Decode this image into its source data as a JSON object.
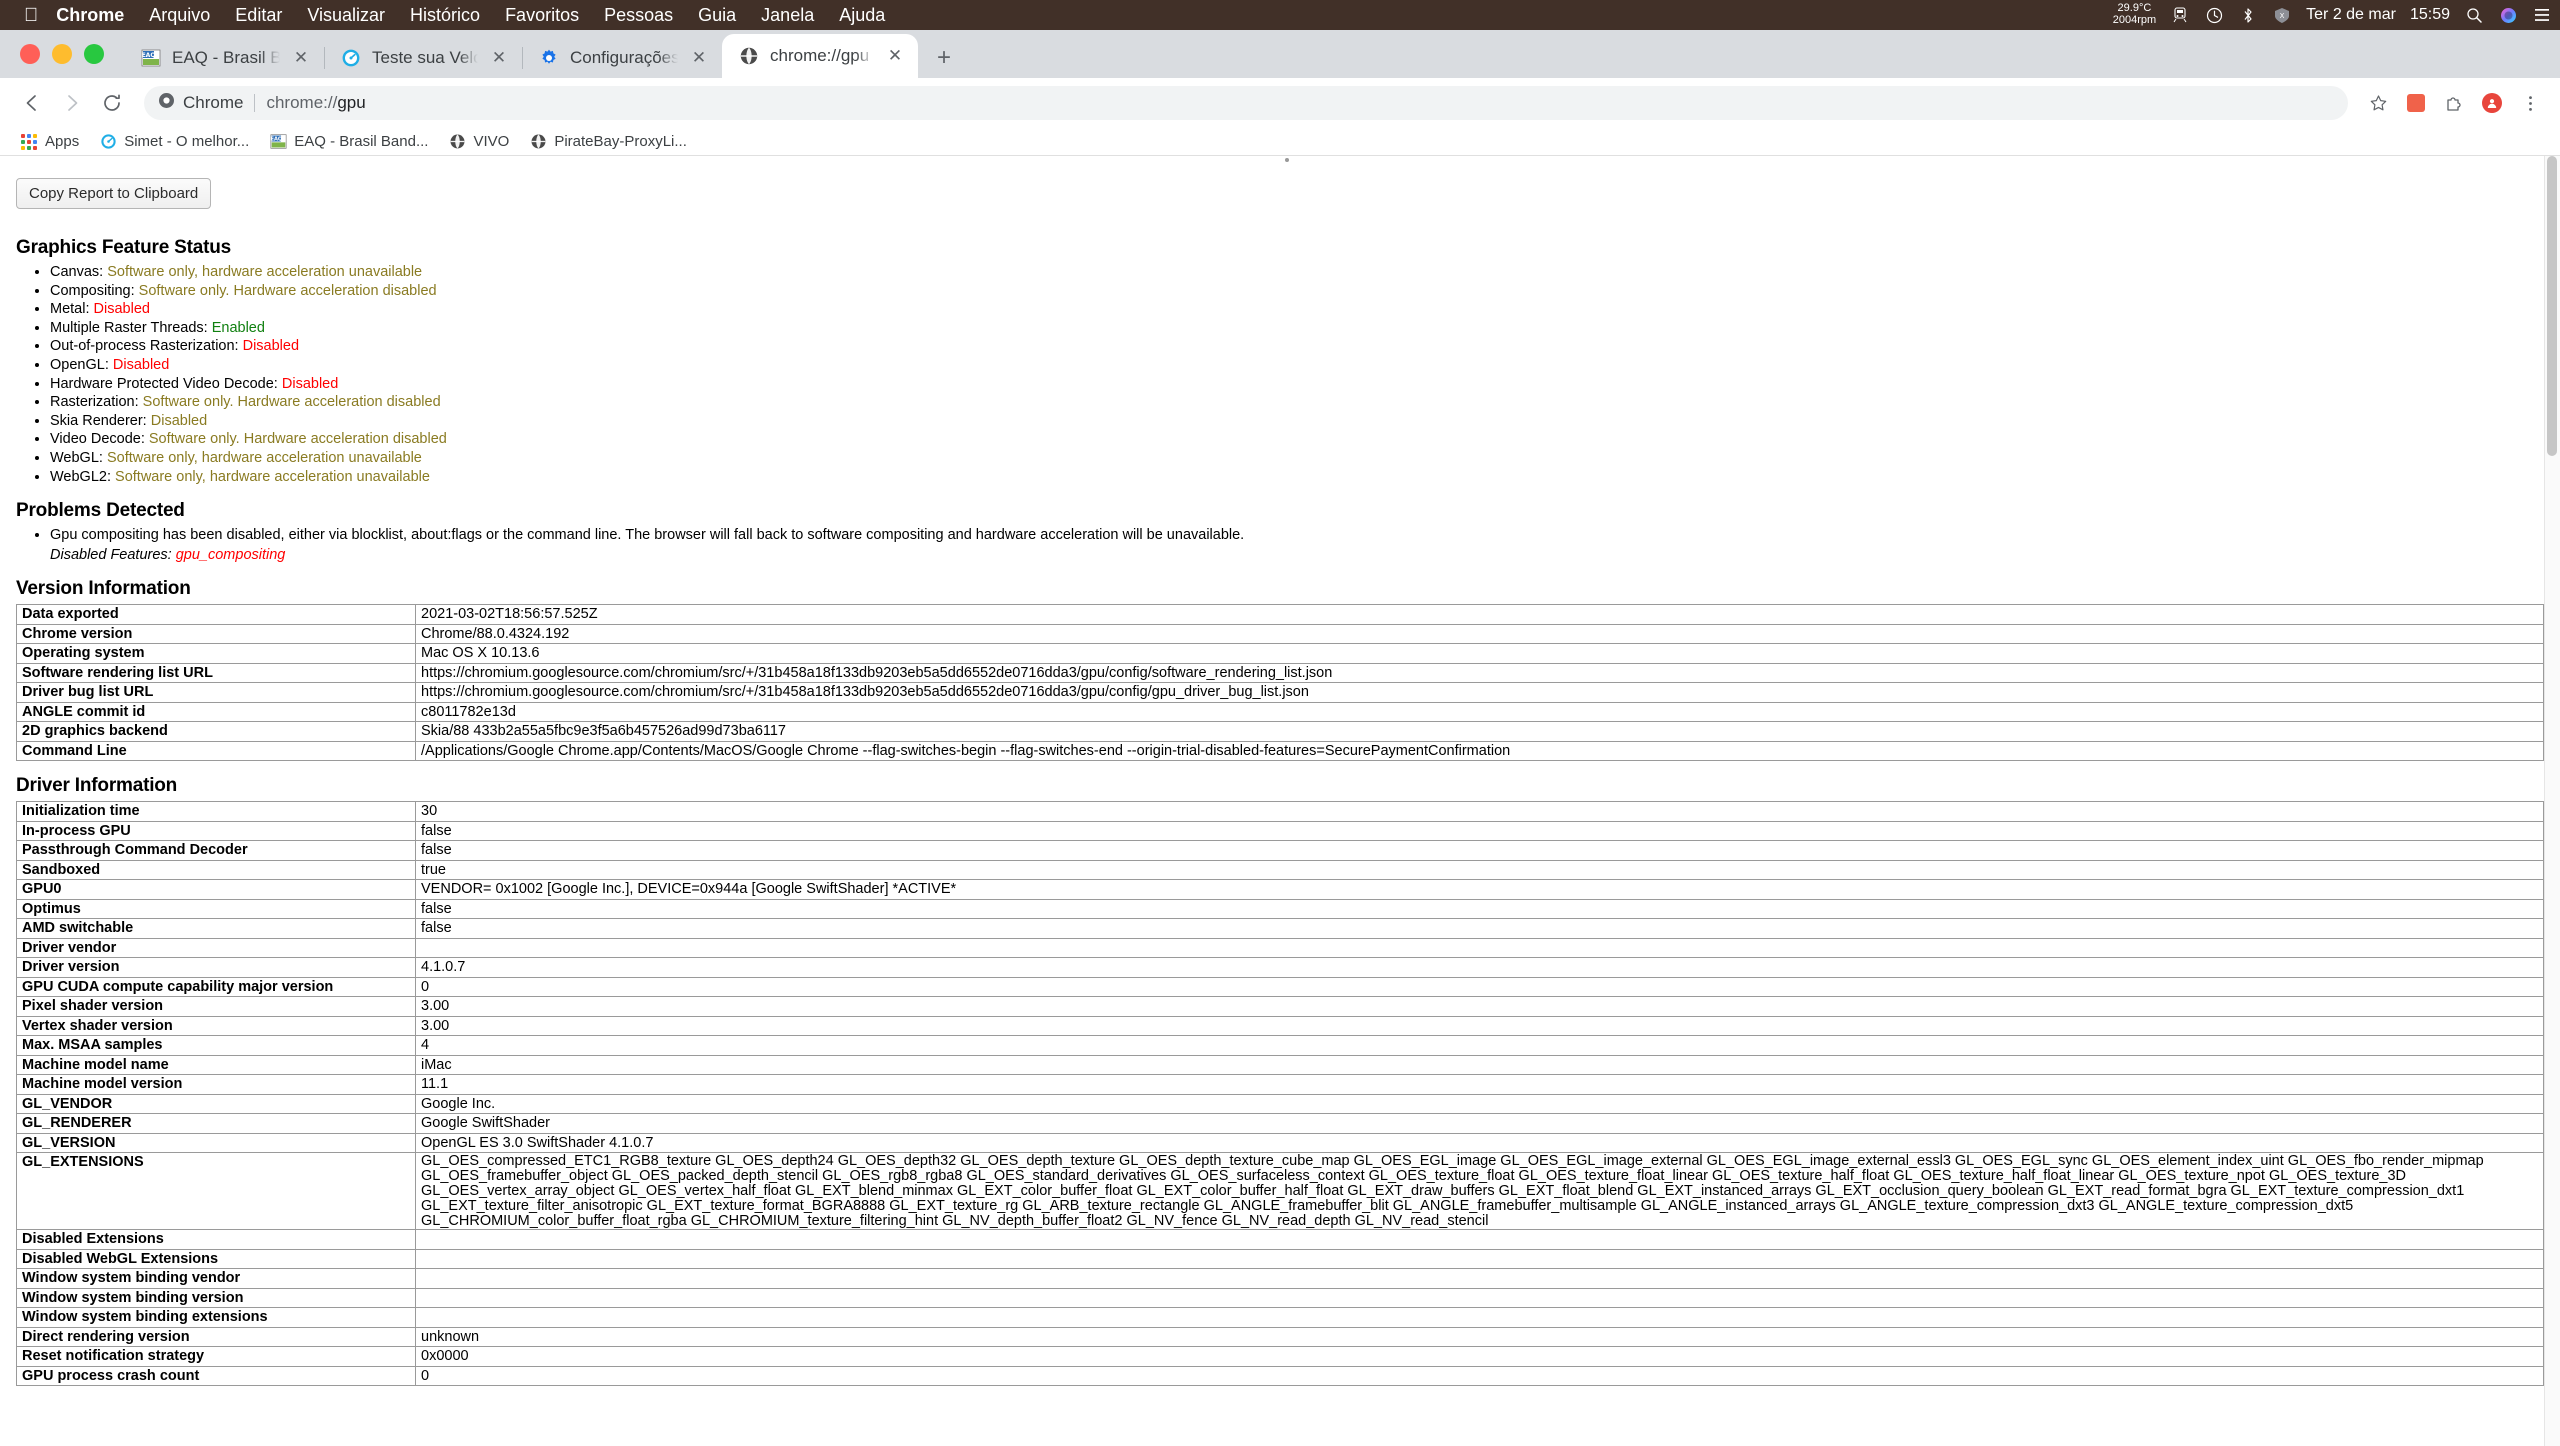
{
  "menubar": {
    "apple_icon": "apple-logo-icon",
    "items": [
      {
        "label": "Chrome",
        "bold": true
      },
      {
        "label": "Arquivo",
        "bold": false
      },
      {
        "label": "Editar",
        "bold": false
      },
      {
        "label": "Visualizar",
        "bold": false
      },
      {
        "label": "Histórico",
        "bold": false
      },
      {
        "label": "Favoritos",
        "bold": false
      },
      {
        "label": "Pessoas",
        "bold": false
      },
      {
        "label": "Guia",
        "bold": false
      },
      {
        "label": "Janela",
        "bold": false
      },
      {
        "label": "Ajuda",
        "bold": false
      }
    ],
    "status": {
      "temperature": "29.9°C",
      "fan_rpm": "2004rpm",
      "datetime": "Ter 2 de mar",
      "time": "15:59"
    }
  },
  "tabs": [
    {
      "title": "EAQ - Brasil Banda Larga - Me",
      "favicon": "eaq-icon",
      "active": false
    },
    {
      "title": "Teste sua Velocidade de Intern",
      "favicon": "speedtest-icon",
      "active": false
    },
    {
      "title": "Configurações: Sobre o Google",
      "favicon": "gear-icon",
      "active": false
    },
    {
      "title": "chrome://gpu",
      "favicon": "globe-icon",
      "active": true
    }
  ],
  "newtab_label": "+",
  "toolbar": {
    "back_label": "←",
    "forward_label": "→",
    "reload_label": "⟳",
    "omnibox_chip": "Chrome",
    "omnibox_url_prefix": "chrome://",
    "omnibox_url_suffix": "gpu",
    "star_label": "☆"
  },
  "bookmarks": [
    {
      "label": "Apps",
      "icon": "apps-grid-icon"
    },
    {
      "label": "Simet - O melhor...",
      "icon": "speedtest-icon"
    },
    {
      "label": "EAQ - Brasil Band...",
      "icon": "eaq-icon"
    },
    {
      "label": "VIVO",
      "icon": "globe-icon"
    },
    {
      "label": "PirateBay-ProxyLi...",
      "icon": "globe-icon"
    }
  ],
  "content": {
    "copy_button": "Copy Report to Clipboard",
    "graphics_feature_status_title": "Graphics Feature Status",
    "features": [
      {
        "name": "Canvas:",
        "status": "Software only, hardware acceleration unavailable",
        "level": "yellow"
      },
      {
        "name": "Compositing:",
        "status": "Software only. Hardware acceleration disabled",
        "level": "yellow"
      },
      {
        "name": "Metal:",
        "status": "Disabled",
        "level": "red"
      },
      {
        "name": "Multiple Raster Threads:",
        "status": "Enabled",
        "level": "green"
      },
      {
        "name": "Out-of-process Rasterization:",
        "status": "Disabled",
        "level": "red"
      },
      {
        "name": "OpenGL:",
        "status": "Disabled",
        "level": "red"
      },
      {
        "name": "Hardware Protected Video Decode:",
        "status": "Disabled",
        "level": "red"
      },
      {
        "name": "Rasterization:",
        "status": "Software only. Hardware acceleration disabled",
        "level": "yellow"
      },
      {
        "name": "Skia Renderer:",
        "status": "Disabled",
        "level": "yellow"
      },
      {
        "name": "Video Decode:",
        "status": "Software only. Hardware acceleration disabled",
        "level": "yellow"
      },
      {
        "name": "WebGL:",
        "status": "Software only, hardware acceleration unavailable",
        "level": "yellow"
      },
      {
        "name": "WebGL2:",
        "status": "Software only, hardware acceleration unavailable",
        "level": "yellow"
      }
    ],
    "problems_title": "Problems Detected",
    "problems": [
      {
        "text": "Gpu compositing has been disabled, either via blocklist, about:flags or the command line. The browser will fall back to software compositing and hardware acceleration will be unavailable.",
        "disabled_label": "Disabled Features:",
        "disabled_features": "gpu_compositing"
      }
    ],
    "version_title": "Version Information",
    "version_rows": [
      {
        "key": "Data exported",
        "value": "2021-03-02T18:56:57.525Z"
      },
      {
        "key": "Chrome version",
        "value": "Chrome/88.0.4324.192"
      },
      {
        "key": "Operating system",
        "value": "Mac OS X 10.13.6"
      },
      {
        "key": "Software rendering list URL",
        "value": "https://chromium.googlesource.com/chromium/src/+/31b458a18f133db9203eb5a5dd6552de0716dda3/gpu/config/software_rendering_list.json"
      },
      {
        "key": "Driver bug list URL",
        "value": "https://chromium.googlesource.com/chromium/src/+/31b458a18f133db9203eb5a5dd6552de0716dda3/gpu/config/gpu_driver_bug_list.json"
      },
      {
        "key": "ANGLE commit id",
        "value": "c8011782e13d"
      },
      {
        "key": "2D graphics backend",
        "value": "Skia/88 433b2a55a5fbc9e3f5a6b457526ad99d73ba6117"
      },
      {
        "key": "Command Line",
        "value": "/Applications/Google Chrome.app/Contents/MacOS/Google Chrome --flag-switches-begin --flag-switches-end --origin-trial-disabled-features=SecurePaymentConfirmation"
      }
    ],
    "driver_title": "Driver Information",
    "driver_rows": [
      {
        "key": "Initialization time",
        "value": "30"
      },
      {
        "key": "In-process GPU",
        "value": "false"
      },
      {
        "key": "Passthrough Command Decoder",
        "value": "false"
      },
      {
        "key": "Sandboxed",
        "value": "true"
      },
      {
        "key": "GPU0",
        "value": "VENDOR= 0x1002 [Google Inc.], DEVICE=0x944a [Google SwiftShader] *ACTIVE*"
      },
      {
        "key": "Optimus",
        "value": "false"
      },
      {
        "key": "AMD switchable",
        "value": "false"
      },
      {
        "key": "Driver vendor",
        "value": ""
      },
      {
        "key": "Driver version",
        "value": "4.1.0.7"
      },
      {
        "key": "GPU CUDA compute capability major version",
        "value": "0"
      },
      {
        "key": "Pixel shader version",
        "value": "3.00"
      },
      {
        "key": "Vertex shader version",
        "value": "3.00"
      },
      {
        "key": "Max. MSAA samples",
        "value": "4"
      },
      {
        "key": "Machine model name",
        "value": "iMac"
      },
      {
        "key": "Machine model version",
        "value": "11.1"
      },
      {
        "key": "GL_VENDOR",
        "value": "Google Inc."
      },
      {
        "key": "GL_RENDERER",
        "value": "Google SwiftShader"
      },
      {
        "key": "GL_VERSION",
        "value": "OpenGL ES 3.0 SwiftShader 4.1.0.7"
      },
      {
        "key": "GL_EXTENSIONS",
        "value": "GL_OES_compressed_ETC1_RGB8_texture GL_OES_depth24 GL_OES_depth32 GL_OES_depth_texture GL_OES_depth_texture_cube_map GL_OES_EGL_image GL_OES_EGL_image_external GL_OES_EGL_image_external_essl3 GL_OES_EGL_sync GL_OES_element_index_uint GL_OES_fbo_render_mipmap GL_OES_framebuffer_object GL_OES_packed_depth_stencil GL_OES_rgb8_rgba8 GL_OES_standard_derivatives GL_OES_surfaceless_context GL_OES_texture_float GL_OES_texture_float_linear GL_OES_texture_half_float GL_OES_texture_half_float_linear GL_OES_texture_npot GL_OES_texture_3D GL_OES_vertex_array_object GL_OES_vertex_half_float GL_EXT_blend_minmax GL_EXT_color_buffer_float GL_EXT_color_buffer_half_float GL_EXT_draw_buffers GL_EXT_float_blend GL_EXT_instanced_arrays GL_EXT_occlusion_query_boolean GL_EXT_read_format_bgra GL_EXT_texture_compression_dxt1 GL_EXT_texture_filter_anisotropic GL_EXT_texture_format_BGRA8888 GL_EXT_texture_rg GL_ARB_texture_rectangle GL_ANGLE_framebuffer_blit GL_ANGLE_framebuffer_multisample GL_ANGLE_instanced_arrays GL_ANGLE_texture_compression_dxt3 GL_ANGLE_texture_compression_dxt5 GL_CHROMIUM_color_buffer_float_rgba GL_CHROMIUM_texture_filtering_hint GL_NV_depth_buffer_float2 GL_NV_fence GL_NV_read_depth GL_NV_read_stencil"
      },
      {
        "key": "Disabled Extensions",
        "value": ""
      },
      {
        "key": "Disabled WebGL Extensions",
        "value": ""
      },
      {
        "key": "Window system binding vendor",
        "value": ""
      },
      {
        "key": "Window system binding version",
        "value": ""
      },
      {
        "key": "Window system binding extensions",
        "value": ""
      },
      {
        "key": "Direct rendering version",
        "value": "unknown"
      },
      {
        "key": "Reset notification strategy",
        "value": "0x0000"
      },
      {
        "key": "GPU process crash count",
        "value": "0"
      }
    ]
  },
  "colors": {
    "menubar_bg": "#413028",
    "chrome_frame": "#d9dce0",
    "accent_red": "#ff0000",
    "accent_green": "#108010",
    "accent_yellow": "#8a7b22"
  }
}
